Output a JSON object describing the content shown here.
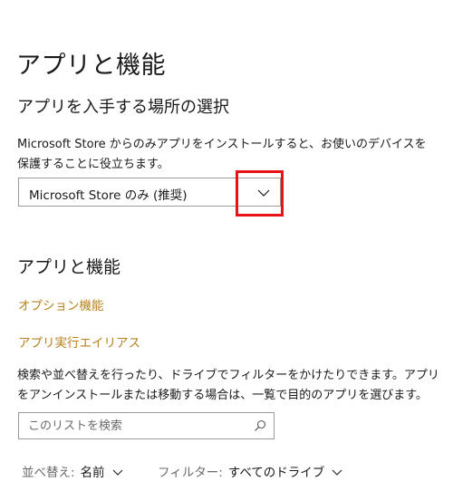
{
  "page": {
    "title": "アプリと機能"
  },
  "install_source": {
    "heading": "アプリを入手する場所の選択",
    "description": "Microsoft Store からのみアプリをインストールすると、お使いのデバイスを保護することに役立ちます。",
    "dropdown_value": "Microsoft Store のみ (推奨)",
    "chevron_icon": "chevron-down-icon",
    "highlight_color": "#e8121a"
  },
  "apps": {
    "heading": "アプリと機能",
    "links": {
      "optional_features": "オプション機能",
      "app_aliases": "アプリ実行エイリアス"
    },
    "link_color": "#b7811b",
    "description": "検索や並べ替えを行ったり、ドライブでフィルターをかけたりできます。アプリをアンインストールまたは移動する場合は、一覧で目的のアプリを選びます。",
    "search": {
      "placeholder": "このリストを検索",
      "icon": "search-icon"
    },
    "sort": {
      "label": "並べ替え:",
      "value": "名前"
    },
    "filter": {
      "label": "フィルター:",
      "value": "すべてのドライブ"
    }
  }
}
